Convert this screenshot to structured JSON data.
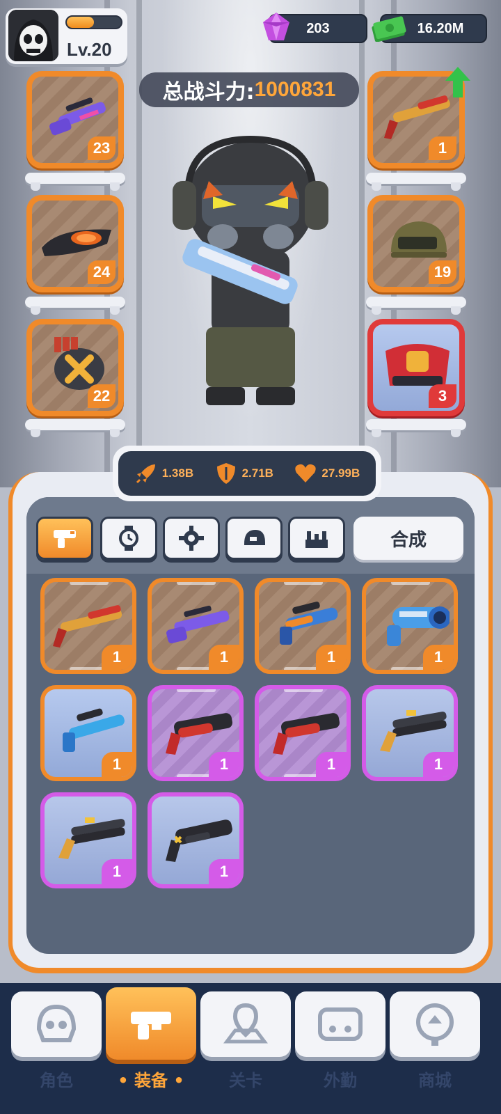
{
  "player": {
    "level": "Lv.20",
    "xp_fraction": 0.5
  },
  "currency": {
    "gems": "203",
    "cash": "16.20M"
  },
  "power": {
    "label": "总战斗力:",
    "value": "1000831"
  },
  "equipped_left": [
    {
      "name": "purple-rifle",
      "count": "23",
      "rarity": "orange"
    },
    {
      "name": "goggles",
      "count": "24",
      "rarity": "orange"
    },
    {
      "name": "ammo-drum",
      "count": "22",
      "rarity": "orange"
    }
  ],
  "equipped_right": [
    {
      "name": "red-shotgun",
      "count": "1",
      "rarity": "orange",
      "upgrade": true
    },
    {
      "name": "helmet",
      "count": "19",
      "rarity": "orange"
    },
    {
      "name": "red-armor",
      "count": "3",
      "rarity": "red"
    }
  ],
  "stats": {
    "attack": "1.38B",
    "defense": "2.71B",
    "health": "27.99B"
  },
  "tabs": [
    "weapon-tab",
    "watch-tab",
    "gear-tab",
    "helmet-tab",
    "armor-tab"
  ],
  "merge_label": "合成",
  "inventory": [
    {
      "name": "red-shotgun",
      "count": "1",
      "rarity": "orange"
    },
    {
      "name": "purple-rifle",
      "count": "1",
      "rarity": "orange"
    },
    {
      "name": "orange-blaster",
      "count": "1",
      "rarity": "orange"
    },
    {
      "name": "blue-cannon",
      "count": "1",
      "rarity": "orange"
    },
    {
      "name": "blue-blaster",
      "count": "1",
      "rarity": "orange-blue"
    },
    {
      "name": "red-shotgun-dark",
      "count": "1",
      "rarity": "purple"
    },
    {
      "name": "red-shotgun-dark",
      "count": "1",
      "rarity": "purple"
    },
    {
      "name": "gold-double-barrel",
      "count": "1",
      "rarity": "purple-plain"
    },
    {
      "name": "gold-double-barrel",
      "count": "1",
      "rarity": "purple-plain"
    },
    {
      "name": "black-shotgun",
      "count": "1",
      "rarity": "purple-plain"
    }
  ],
  "nav": [
    {
      "label": "角色",
      "icon": "skull-icon"
    },
    {
      "label": "• 装备 •",
      "icon": "gun-icon",
      "active": true
    },
    {
      "label": "关卡",
      "icon": "map-pin-icon"
    },
    {
      "label": "外勤",
      "icon": "controller-icon"
    },
    {
      "label": "商城",
      "icon": "shop-icon"
    }
  ],
  "colors": {
    "orange": "#f08a2a",
    "purple": "#d45be8",
    "red": "#e03a3a",
    "navy": "#1d2d4a"
  }
}
